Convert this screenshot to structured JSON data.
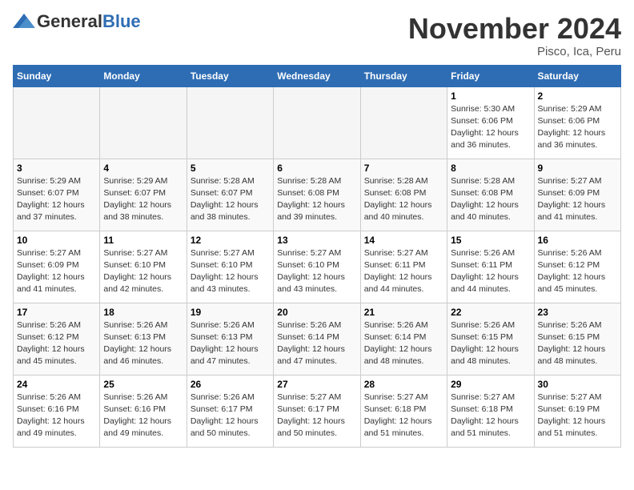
{
  "header": {
    "logo_general": "General",
    "logo_blue": "Blue",
    "month_title": "November 2024",
    "location": "Pisco, Ica, Peru"
  },
  "weekdays": [
    "Sunday",
    "Monday",
    "Tuesday",
    "Wednesday",
    "Thursday",
    "Friday",
    "Saturday"
  ],
  "weeks": [
    [
      {
        "day": "",
        "info": ""
      },
      {
        "day": "",
        "info": ""
      },
      {
        "day": "",
        "info": ""
      },
      {
        "day": "",
        "info": ""
      },
      {
        "day": "",
        "info": ""
      },
      {
        "day": "1",
        "info": "Sunrise: 5:30 AM\nSunset: 6:06 PM\nDaylight: 12 hours\nand 36 minutes."
      },
      {
        "day": "2",
        "info": "Sunrise: 5:29 AM\nSunset: 6:06 PM\nDaylight: 12 hours\nand 36 minutes."
      }
    ],
    [
      {
        "day": "3",
        "info": "Sunrise: 5:29 AM\nSunset: 6:07 PM\nDaylight: 12 hours\nand 37 minutes."
      },
      {
        "day": "4",
        "info": "Sunrise: 5:29 AM\nSunset: 6:07 PM\nDaylight: 12 hours\nand 38 minutes."
      },
      {
        "day": "5",
        "info": "Sunrise: 5:28 AM\nSunset: 6:07 PM\nDaylight: 12 hours\nand 38 minutes."
      },
      {
        "day": "6",
        "info": "Sunrise: 5:28 AM\nSunset: 6:08 PM\nDaylight: 12 hours\nand 39 minutes."
      },
      {
        "day": "7",
        "info": "Sunrise: 5:28 AM\nSunset: 6:08 PM\nDaylight: 12 hours\nand 40 minutes."
      },
      {
        "day": "8",
        "info": "Sunrise: 5:28 AM\nSunset: 6:08 PM\nDaylight: 12 hours\nand 40 minutes."
      },
      {
        "day": "9",
        "info": "Sunrise: 5:27 AM\nSunset: 6:09 PM\nDaylight: 12 hours\nand 41 minutes."
      }
    ],
    [
      {
        "day": "10",
        "info": "Sunrise: 5:27 AM\nSunset: 6:09 PM\nDaylight: 12 hours\nand 41 minutes."
      },
      {
        "day": "11",
        "info": "Sunrise: 5:27 AM\nSunset: 6:10 PM\nDaylight: 12 hours\nand 42 minutes."
      },
      {
        "day": "12",
        "info": "Sunrise: 5:27 AM\nSunset: 6:10 PM\nDaylight: 12 hours\nand 43 minutes."
      },
      {
        "day": "13",
        "info": "Sunrise: 5:27 AM\nSunset: 6:10 PM\nDaylight: 12 hours\nand 43 minutes."
      },
      {
        "day": "14",
        "info": "Sunrise: 5:27 AM\nSunset: 6:11 PM\nDaylight: 12 hours\nand 44 minutes."
      },
      {
        "day": "15",
        "info": "Sunrise: 5:26 AM\nSunset: 6:11 PM\nDaylight: 12 hours\nand 44 minutes."
      },
      {
        "day": "16",
        "info": "Sunrise: 5:26 AM\nSunset: 6:12 PM\nDaylight: 12 hours\nand 45 minutes."
      }
    ],
    [
      {
        "day": "17",
        "info": "Sunrise: 5:26 AM\nSunset: 6:12 PM\nDaylight: 12 hours\nand 45 minutes."
      },
      {
        "day": "18",
        "info": "Sunrise: 5:26 AM\nSunset: 6:13 PM\nDaylight: 12 hours\nand 46 minutes."
      },
      {
        "day": "19",
        "info": "Sunrise: 5:26 AM\nSunset: 6:13 PM\nDaylight: 12 hours\nand 47 minutes."
      },
      {
        "day": "20",
        "info": "Sunrise: 5:26 AM\nSunset: 6:14 PM\nDaylight: 12 hours\nand 47 minutes."
      },
      {
        "day": "21",
        "info": "Sunrise: 5:26 AM\nSunset: 6:14 PM\nDaylight: 12 hours\nand 48 minutes."
      },
      {
        "day": "22",
        "info": "Sunrise: 5:26 AM\nSunset: 6:15 PM\nDaylight: 12 hours\nand 48 minutes."
      },
      {
        "day": "23",
        "info": "Sunrise: 5:26 AM\nSunset: 6:15 PM\nDaylight: 12 hours\nand 48 minutes."
      }
    ],
    [
      {
        "day": "24",
        "info": "Sunrise: 5:26 AM\nSunset: 6:16 PM\nDaylight: 12 hours\nand 49 minutes."
      },
      {
        "day": "25",
        "info": "Sunrise: 5:26 AM\nSunset: 6:16 PM\nDaylight: 12 hours\nand 49 minutes."
      },
      {
        "day": "26",
        "info": "Sunrise: 5:26 AM\nSunset: 6:17 PM\nDaylight: 12 hours\nand 50 minutes."
      },
      {
        "day": "27",
        "info": "Sunrise: 5:27 AM\nSunset: 6:17 PM\nDaylight: 12 hours\nand 50 minutes."
      },
      {
        "day": "28",
        "info": "Sunrise: 5:27 AM\nSunset: 6:18 PM\nDaylight: 12 hours\nand 51 minutes."
      },
      {
        "day": "29",
        "info": "Sunrise: 5:27 AM\nSunset: 6:18 PM\nDaylight: 12 hours\nand 51 minutes."
      },
      {
        "day": "30",
        "info": "Sunrise: 5:27 AM\nSunset: 6:19 PM\nDaylight: 12 hours\nand 51 minutes."
      }
    ]
  ]
}
